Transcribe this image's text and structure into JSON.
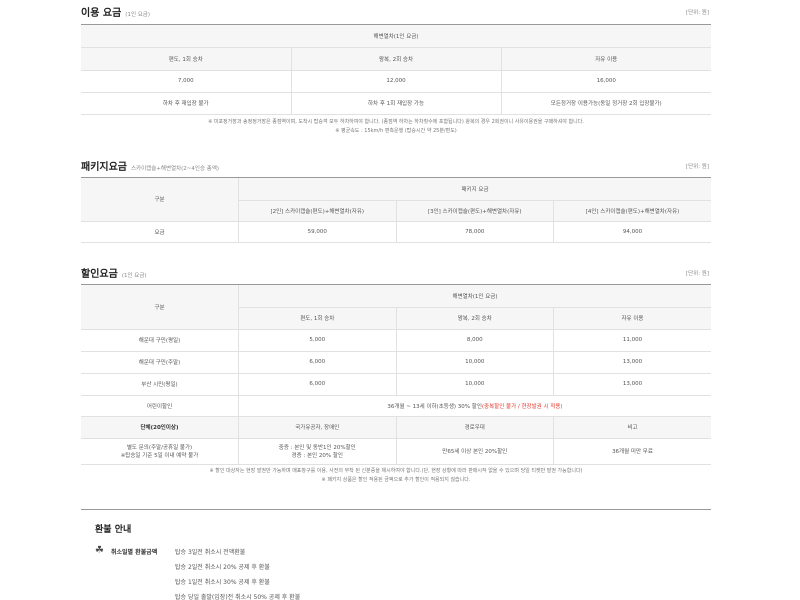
{
  "usage": {
    "title": "이용 요금",
    "sub": "(1인 요금)",
    "unit": "[단위: 원]",
    "top_header": "해변열차(1인 요금)",
    "cols": [
      "편도, 1회 승차",
      "왕복, 2회 승차",
      "자유 이용"
    ],
    "prices": [
      "7,000",
      "12,000",
      "16,000"
    ],
    "rules": [
      "하차 후 재입장 불가",
      "하차 후 1회 재입장 가능",
      "모든정거장 이용가능(동일 정거장 2회 입장불가)"
    ],
    "notes": [
      "※ 미포정거장과 송정정거장은 종점역이며, 도착시 탑승객 모두 하차하여야 합니다. (종점역 하차는 하차횟수에 포함됩니다) 왕복의 경우 2회권이니 사유이용권을 구매하셔야 합니다.",
      "※ 평균속도 : 15km/h 편측운행 (탑승시간 약 25분/편도)"
    ]
  },
  "package": {
    "title": "패키지요금",
    "sub": "스카이캡슐+해변열차(2~4인승 총액)",
    "unit": "[단위: 원]",
    "col0": "구분",
    "top_header": "패키지 요금",
    "cols": [
      "[2인] 스카이캡슐(편도)+해변열차(자유)",
      "[3인] 스카이캡슐(편도)+해변열차(자유)",
      "[4인] 스카이캡슐(편도)+해변열차(자유)"
    ],
    "row_label": "요금",
    "prices": [
      "59,000",
      "78,000",
      "94,000"
    ]
  },
  "discount": {
    "title": "할인요금",
    "sub": "(1인 요금)",
    "unit": "[단위: 원]",
    "col0": "구분",
    "top_header": "해변열차(1인 요금)",
    "cols": [
      "편도, 1회 승차",
      "왕복, 2회 승차",
      "자유 이용"
    ],
    "rows": [
      {
        "label": "해운대 구민(평일)",
        "v": [
          "5,000",
          "8,000",
          "11,000"
        ]
      },
      {
        "label": "해운대 구민(주말)",
        "v": [
          "6,000",
          "10,000",
          "13,000"
        ]
      },
      {
        "label": "부산 시민(평일)",
        "v": [
          "6,000",
          "10,000",
          "13,000"
        ]
      }
    ],
    "child_label": "어린이할인",
    "child_text": "36개월 ~ 13세 이하(초등생) 30% 할인",
    "child_red": "(중복할인 불가 / 현장발권 시 적용)",
    "group_headers": [
      "단체(20인이상)",
      "국가유공자, 장애인",
      "경로우대",
      "비고"
    ],
    "group_cells": [
      [
        "별도 문의(주말/공휴일 불가)",
        "※탑승일 기준 5일 이내 예약 불가"
      ],
      [
        "중증 : 본인 및 동반1인 20%할인",
        "경증 : 본인 20% 할인"
      ],
      [
        "만65세 이상 본인 20%할인"
      ],
      [
        "36개월 미만 무료"
      ]
    ],
    "notes": [
      "※ 할인 대상자는 현장 발권만 가능하며 매표창구를 이용, 사전의 부착 된 신분증을 제시하여야 합니다.(단, 현장 상황에 따라 판매시작 없을 수 있으며 당일 티켓만 발권 가능합니다)",
      "※ 패키지 상품은 할인 적용된 금액으로 추가 할인이 적용되지 않습니다."
    ]
  },
  "refund": {
    "title": "환불 안내",
    "label": "취소일별 환불금액",
    "lines": [
      "탑승 3일전 취소시 전액환불",
      "탑승 2일전 취소시 20% 공제 후 환불",
      "탑승 1일전 취소시 30% 공제 후 환불",
      "탑승 당일 출발(입장)전 취소시 50% 공제 후 환불"
    ]
  }
}
